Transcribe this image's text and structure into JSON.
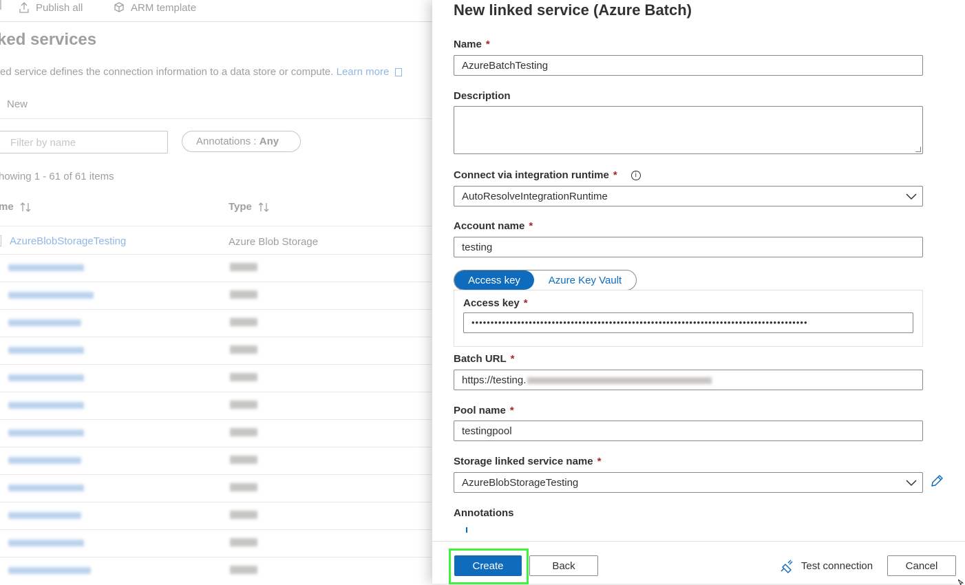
{
  "toolbar": {
    "publish_all": "Publish all",
    "arm_template": "ARM template"
  },
  "page": {
    "title": "ked services",
    "description": "ed service defines the connection information to a data store or compute.",
    "learn_more": "Learn more",
    "new_label": "New",
    "filter_placeholder": "Filter by name",
    "annotations_label": "Annotations : ",
    "annotations_value": "Any",
    "showing": "howing 1 - 61 of 61 items",
    "col_name": "me",
    "col_type": "Type",
    "first_row": {
      "name": "AzureBlobStorageTesting",
      "type": "Azure Blob Storage"
    }
  },
  "panel": {
    "title": "New linked service (Azure Batch)",
    "name_label": "Name",
    "name_value": "AzureBatchTesting",
    "description_label": "Description",
    "description_value": "",
    "runtime_label": "Connect via integration runtime",
    "runtime_value": "AutoResolveIntegrationRuntime",
    "account_label": "Account name",
    "account_value": "testing",
    "tab_access_key": "Access key",
    "tab_key_vault": "Azure Key Vault",
    "access_key_label": "Access key",
    "access_key_value": "••••••••••••••••••••••••••••••••••••••••••••••••••••••••••••••••••••••••••••••••••••••••",
    "batch_url_label": "Batch URL",
    "batch_url_value": "https://testing.",
    "pool_label": "Pool name",
    "pool_value": "testingpool",
    "storage_label": "Storage linked service name",
    "storage_value": "AzureBlobStorageTesting",
    "annotations_label": "Annotations",
    "required_mark": "*",
    "info_glyph": "i"
  },
  "footer": {
    "create": "Create",
    "back": "Back",
    "test_connection": "Test connection",
    "cancel": "Cancel"
  },
  "colors": {
    "accent": "#0f6cbd",
    "required": "#a4262c",
    "highlight": "#3ef23e"
  }
}
